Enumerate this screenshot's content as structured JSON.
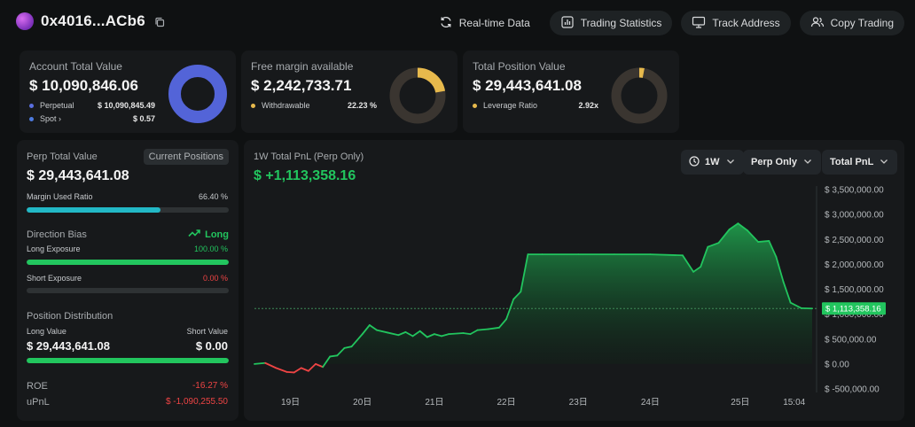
{
  "header": {
    "address": "0x4016...ACb6",
    "nav": [
      {
        "label": "Real-time Data"
      },
      {
        "label": "Trading Statistics"
      },
      {
        "label": "Track Address"
      },
      {
        "label": "Copy Trading"
      }
    ]
  },
  "account": {
    "title": "Account Total Value",
    "value": "$ 10,090,846.06",
    "rows": [
      {
        "label": "Perpetual",
        "value": "$ 10,090,845.49",
        "color": "#5a6fe0"
      },
      {
        "label": "Spot ›",
        "value": "$ 0.57",
        "color": "#4d7be0"
      }
    ],
    "share": 0.99999
  },
  "margin": {
    "title": "Free margin available",
    "value": "$ 2,242,733.71",
    "rows": [
      {
        "label": "Withdrawable",
        "value": "22.23 %",
        "color": "#e7b94c"
      }
    ],
    "share": 0.2223
  },
  "position": {
    "title": "Total Position Value",
    "value": "$ 29,443,641.08",
    "rows": [
      {
        "label": "Leverage Ratio",
        "value": "2.92x",
        "color": "#e7b94c"
      }
    ],
    "share": 0.03
  },
  "perp": {
    "title": "Perp Total Value",
    "badge": "Current Positions",
    "value": "$ 29,443,641.08",
    "margin_label": "Margin Used Ratio",
    "margin_value": "66.40 %",
    "margin_ratio": 0.664,
    "direction_label": "Direction Bias",
    "direction_value": "Long",
    "long_label": "Long Exposure",
    "long_value": "100.00 %",
    "long_ratio": 1.0,
    "short_label": "Short Exposure",
    "short_value": "0.00 %",
    "short_ratio": 0.0,
    "dist_label": "Position Distribution",
    "long_value_label": "Long Value",
    "short_value_label": "Short Value",
    "long_amount": "$ 29,443,641.08",
    "short_amount": "$ 0.00",
    "dist_ratio": 1.0,
    "roe_label": "ROE",
    "roe_value": "-16.27 %",
    "upnl_label": "uPnL",
    "upnl_value": "$ -1,090,255.50"
  },
  "chart": {
    "title": "1W Total PnL (Perp Only)",
    "value": "$ +1,113,358.16",
    "controls": {
      "period": "1W",
      "scope": "Perp Only",
      "metric": "Total PnL"
    },
    "last_label": "$ 1,113,358.16"
  },
  "chart_data": {
    "type": "area",
    "title": "1W Total PnL (Perp Only)",
    "x_ticks": [
      "19日",
      "20日",
      "21日",
      "22日",
      "23日",
      "24日",
      "25日",
      "15:04"
    ],
    "x_tick_pos": [
      0.5,
      1.5,
      2.5,
      3.5,
      4.5,
      5.5,
      6.75,
      7.5
    ],
    "y_ticks": [
      "$ 3,500,000.00",
      "$ 3,000,000.00",
      "$ 2,500,000.00",
      "$ 2,000,000.00",
      "$ 1,500,000.00",
      "$ 1,000,000.00",
      "$ 500,000.00",
      "$ 0.00",
      "$ -500,000.00"
    ],
    "y_tick_values": [
      3500000,
      3000000,
      2500000,
      2000000,
      1500000,
      1000000,
      500000,
      0,
      -500000
    ],
    "ylim": [
      -500000,
      3500000
    ],
    "xlim": [
      0,
      7.75
    ],
    "points": [
      [
        0.0,
        0
      ],
      [
        0.15,
        20000
      ],
      [
        0.3,
        -80000
      ],
      [
        0.45,
        -160000
      ],
      [
        0.55,
        -170000
      ],
      [
        0.65,
        -80000
      ],
      [
        0.75,
        -140000
      ],
      [
        0.85,
        0
      ],
      [
        0.95,
        -60000
      ],
      [
        1.05,
        150000
      ],
      [
        1.15,
        170000
      ],
      [
        1.25,
        320000
      ],
      [
        1.35,
        350000
      ],
      [
        1.5,
        600000
      ],
      [
        1.6,
        780000
      ],
      [
        1.7,
        680000
      ],
      [
        1.85,
        630000
      ],
      [
        2.0,
        580000
      ],
      [
        2.1,
        640000
      ],
      [
        2.2,
        560000
      ],
      [
        2.3,
        660000
      ],
      [
        2.4,
        540000
      ],
      [
        2.5,
        600000
      ],
      [
        2.6,
        560000
      ],
      [
        2.7,
        600000
      ],
      [
        2.9,
        620000
      ],
      [
        3.0,
        600000
      ],
      [
        3.1,
        680000
      ],
      [
        3.25,
        700000
      ],
      [
        3.4,
        730000
      ],
      [
        3.5,
        900000
      ],
      [
        3.6,
        1300000
      ],
      [
        3.7,
        1450000
      ],
      [
        3.8,
        2200000
      ],
      [
        4.0,
        2200000
      ],
      [
        4.5,
        2200000
      ],
      [
        5.0,
        2200000
      ],
      [
        5.5,
        2200000
      ],
      [
        5.95,
        2180000
      ],
      [
        6.1,
        1850000
      ],
      [
        6.2,
        1950000
      ],
      [
        6.3,
        2350000
      ],
      [
        6.45,
        2430000
      ],
      [
        6.6,
        2700000
      ],
      [
        6.72,
        2820000
      ],
      [
        6.85,
        2680000
      ],
      [
        7.0,
        2450000
      ],
      [
        7.15,
        2470000
      ],
      [
        7.25,
        2150000
      ],
      [
        7.35,
        1650000
      ],
      [
        7.45,
        1230000
      ],
      [
        7.6,
        1120000
      ],
      [
        7.75,
        1113358
      ]
    ],
    "last_value": 1113358,
    "colors": {
      "up": "#22c55e",
      "down": "#ef4444",
      "fill": "#1f8f45"
    }
  },
  "colors": {
    "accent_green": "#22c55e",
    "accent_red": "#ef4444",
    "accent_teal": "#22b8c6",
    "accent_gold": "#e7b94c",
    "accent_blue": "#5a6fe0"
  }
}
